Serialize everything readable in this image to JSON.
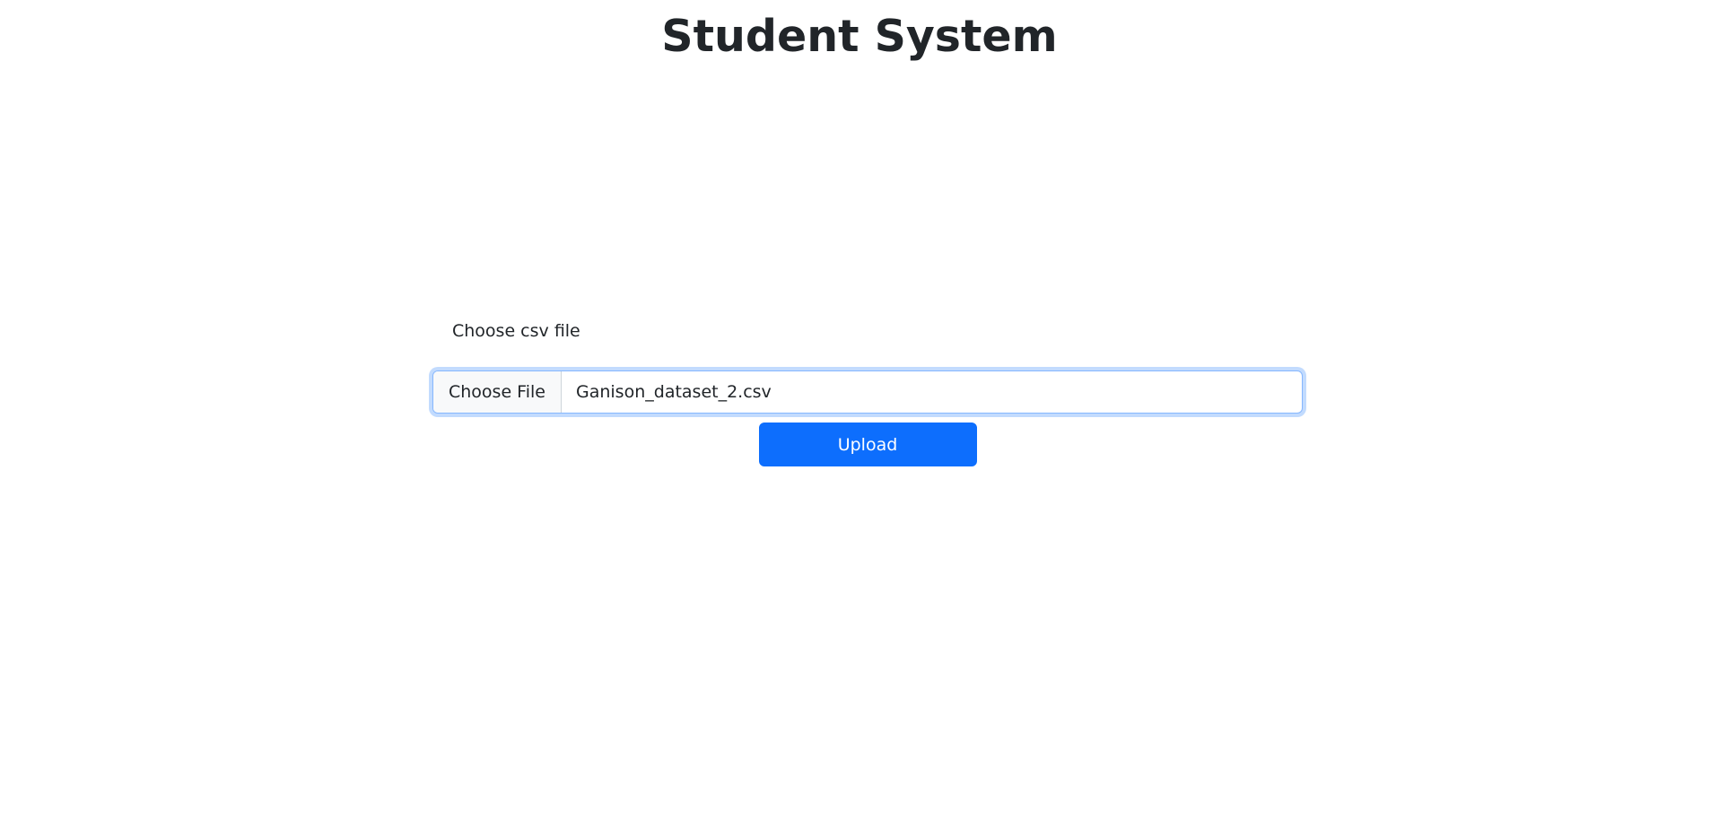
{
  "header": {
    "title": "Student System"
  },
  "form": {
    "label": "Choose csv file",
    "file_button_label": "Choose File",
    "file_name": "Ganison_dataset_2.csv",
    "upload_label": "Upload"
  },
  "colors": {
    "primary": "#0d6efd",
    "text": "#212529",
    "focus_border": "#86b7fe",
    "file_button_bg": "#f8f9fa"
  }
}
